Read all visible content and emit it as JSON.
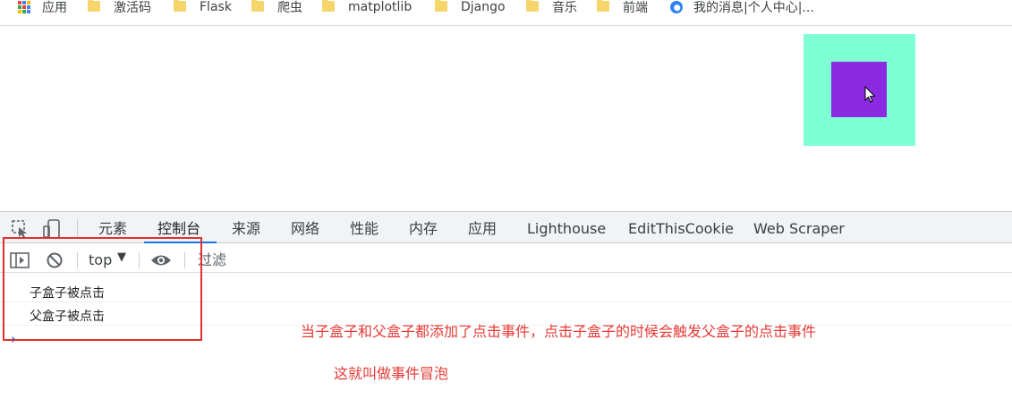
{
  "bookmarks": [
    {
      "label": "应用",
      "icon": "apps-icon"
    },
    {
      "label": "激活码",
      "icon": "folder-icon"
    },
    {
      "label": "Flask",
      "icon": "folder-icon"
    },
    {
      "label": "爬虫",
      "icon": "folder-icon"
    },
    {
      "label": "matplotlib",
      "icon": "folder-icon"
    },
    {
      "label": "Django",
      "icon": "folder-icon"
    },
    {
      "label": "音乐",
      "icon": "folder-icon"
    },
    {
      "label": "前端",
      "icon": "folder-icon"
    },
    {
      "label": "我的消息|个人中心|...",
      "icon": "baidu-icon"
    }
  ],
  "page": {
    "parent_color": "#7fffd4",
    "child_color": "#8a2be2"
  },
  "devtools": {
    "tabs": [
      {
        "label": "元素"
      },
      {
        "label": "控制台",
        "active": true
      },
      {
        "label": "来源"
      },
      {
        "label": "网络"
      },
      {
        "label": "性能"
      },
      {
        "label": "内存"
      },
      {
        "label": "应用"
      },
      {
        "label": "Lighthouse"
      },
      {
        "label": "EditThisCookie"
      },
      {
        "label": "Web Scraper"
      }
    ],
    "context": "top",
    "filter_placeholder": "过滤",
    "console_lines": [
      "子盒子被点击",
      "父盒子被点击"
    ],
    "accent_color": "#1a73e8"
  },
  "annotations": {
    "line1": "当子盒子和父盒子都添加了点击事件，点击子盒子的时候会触发父盒子的点击事件",
    "line2": "这就叫做事件冒泡",
    "color": "#e53935"
  }
}
